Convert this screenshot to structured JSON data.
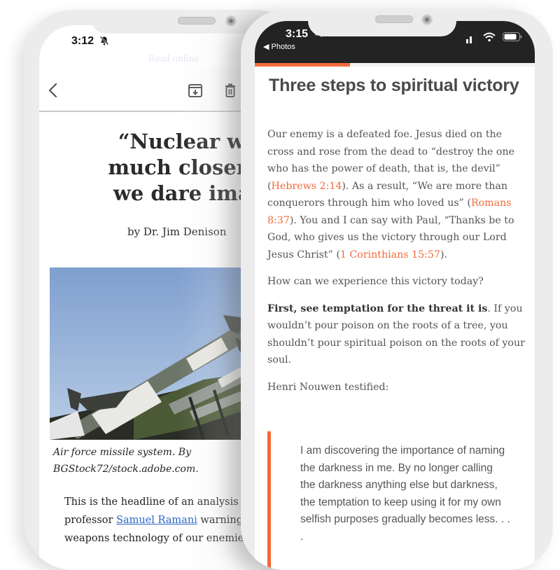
{
  "left_phone": {
    "status_bar": {
      "time": "3:12",
      "silent_icon": "bell-slash-icon"
    },
    "read_online_label": "Read online",
    "toolbar": {
      "back_icon": "chevron-left-icon",
      "archive_icon": "archive-icon",
      "delete_icon": "trash-icon"
    },
    "article": {
      "headline_lines": [
        "“Nuclear war",
        "much closer th",
        "we dare imagi"
      ],
      "byline": "by Dr. Jim Denison",
      "image_alt": "Air force missile system",
      "caption_lines": [
        "Air force missile system. By",
        "BGStock72/stock.adobe.com."
      ],
      "body": {
        "line1": "This is the headline of an analysis",
        "line2_before": "professor ",
        "line2_link": "Samuel Ramani",
        "line2_after": " warning",
        "line3": "weapons technology of our enemie"
      }
    }
  },
  "right_phone": {
    "status_bar": {
      "time": "3:15",
      "back_app": "◀ Photos",
      "silent_icon": "bell-slash-icon",
      "signal_icon": "signal-icon",
      "wifi_icon": "wifi-icon",
      "battery_icon": "battery-icon"
    },
    "reading_progress_percent": 34,
    "accent_color": "#f26b3a",
    "title": "Three steps to spiritual victory",
    "paragraphs": {
      "p1": {
        "t1": "Our enemy is a defeated foe. Jesus died on the cross and rose from the dead to “destroy the one who has the power of death, that is, the devil” (",
        "link1": "Hebrews 2:14",
        "t2": "). As a result, “We are more than conquerors through him who loved us” (",
        "link2": "Romans 8:37",
        "t3": "). You and I can say with Paul, “Thanks be to God, who gives us the victory through our Lord Jesus Christ” (",
        "link3": "1 Corinthians 15:57",
        "t4": ")."
      },
      "p2": "How can we experience this victory today?",
      "p3": {
        "bold": "First, see temptation for the threat it is",
        "rest": ". If you wouldn’t pour poison on the roots of a tree, you shouldn’t pour spiritual poison on the roots of your soul."
      },
      "p4": "Henri Nouwen testified:"
    },
    "blockquote": "I am discovering the importance of naming the darkness in me. By no longer calling the darkness anything else but darkness, the temptation to keep using it for my own selfish purposes gradually becomes less. . . ."
  }
}
